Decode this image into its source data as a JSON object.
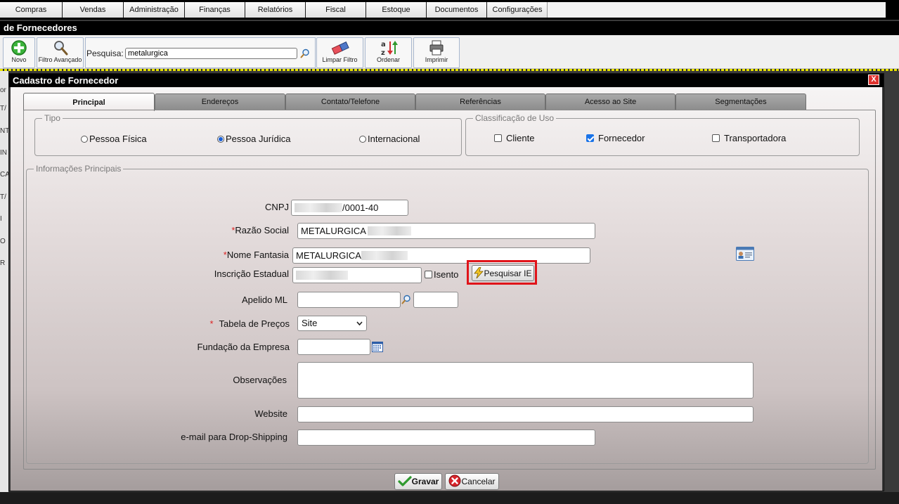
{
  "menu": {
    "items": [
      "Compras",
      "Vendas",
      "Administração",
      "Finanças",
      "Relatórios",
      "Fiscal",
      "Estoque",
      "Documentos",
      "Configurações"
    ]
  },
  "section_title": "de Fornecedores",
  "toolbar": {
    "novo_label": "Novo",
    "filtro_label": "Filtro Avançado",
    "search_label": "Pesquisa:",
    "search_value": "metalurgica",
    "limpar_label": "Limpar Filtro",
    "ordenar_label": "Ordenar",
    "imprimir_label": "Imprimir"
  },
  "background_fragments": [
    "or",
    "T/",
    "NT",
    "IN",
    "CA",
    "T/",
    "I",
    "O",
    "R"
  ],
  "modal": {
    "title": "Cadastro de Fornecedor",
    "close_label": "X",
    "tabs": [
      "Principal",
      "Endereços",
      "Contato/Telefone",
      "Referências",
      "Acesso ao Site",
      "Segmentações"
    ],
    "tipo": {
      "legend": "Tipo",
      "options": [
        "Pessoa Física",
        "Pessoa Jurídica",
        "Internacional"
      ],
      "selected": "Pessoa Jurídica"
    },
    "classificacao": {
      "legend": "Classificação de Uso",
      "options": [
        "Cliente",
        "Fornecedor",
        "Transportadora"
      ],
      "checked": [
        "Fornecedor"
      ]
    },
    "info": {
      "legend": "Informações Principais",
      "cnpj_label": "CNPJ",
      "cnpj_value": "/0001-40",
      "razao_required": "*",
      "razao_label": "Razão Social",
      "razao_value": "METALURGICA",
      "fantasia_required": "*",
      "fantasia_label": "Nome Fantasia",
      "fantasia_value": "METALURGICA",
      "ie_label": "Inscrição Estadual",
      "isento_label": "Isento",
      "pesquisar_ie_label": "Pesquisar IE",
      "apelido_label": "Apelido ML",
      "tabela_required": "*",
      "tabela_label": "Tabela de Preços",
      "tabela_value": "Site",
      "fundacao_label": "Fundação da Empresa",
      "observacoes_label": "Observações",
      "website_label": "Website",
      "email_label": "e-mail para Drop-Shipping"
    },
    "buttons": {
      "gravar_label": "Gravar",
      "cancelar_label": "Cancelar"
    }
  }
}
